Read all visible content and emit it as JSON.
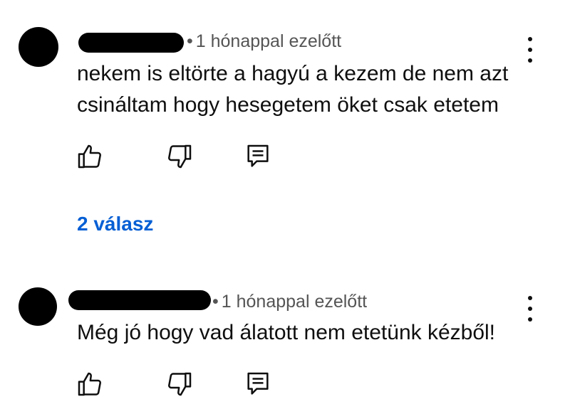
{
  "colors": {
    "link": "#065fd4",
    "meta": "#555555",
    "text": "#0f0f0f"
  },
  "comments": [
    {
      "meta_dot": "•",
      "time": "1 hónappal ezelőtt",
      "text_lines": [
        "nekem is eltörte a hagyú a kezem de nem azt",
        "csináltam hogy hesegetem öket csak etetem"
      ],
      "replies_label": "2 válasz",
      "icons": [
        "like-icon",
        "dislike-icon",
        "reply-icon",
        "more-icon"
      ]
    },
    {
      "meta_dot": "•",
      "time": "1 hónappal ezelőtt",
      "text_lines": [
        "Még jó hogy vad álatott nem etetünk kézből!"
      ],
      "icons": [
        "like-icon",
        "dislike-icon",
        "reply-icon",
        "more-icon"
      ]
    }
  ]
}
